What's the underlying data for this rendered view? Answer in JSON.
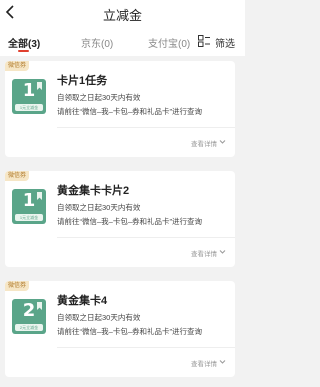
{
  "header": {
    "title": "立减金"
  },
  "tabs": [
    {
      "label": "全部(3)"
    },
    {
      "label": "京东(0)"
    },
    {
      "label": "支付宝(0)"
    }
  ],
  "filter_label": "筛选",
  "cards": [
    {
      "badge": "微信券",
      "thumb_num": "1",
      "thumb_label": "1元立减金",
      "name": "卡片1任务",
      "validity": "自领取之日起30天内有效",
      "note": "请前往“微信–我–卡包–券和礼品卡”进行查询",
      "details": "查看详情"
    },
    {
      "badge": "微信券",
      "thumb_num": "1",
      "thumb_label": "1元立减金",
      "name": "黄金集卡卡片2",
      "validity": "自领取之日起30天内有效",
      "note": "请前往“微信–我–卡包–券和礼品卡”进行查询",
      "details": "查看详情"
    },
    {
      "badge": "微信券",
      "thumb_num": "2",
      "thumb_label": "2元立减金",
      "name": "黄金集卡4",
      "validity": "自领取之日起30天内有效",
      "note": "请前往“微信–我–卡包–券和礼品卡”进行查询",
      "details": "查看详情"
    }
  ],
  "colors": {
    "accent": "#e0402f",
    "thumb_green": "#5aa589",
    "badge_bg": "#f6e6c6",
    "badge_text": "#b07a2a",
    "background": "#f2f2f2"
  },
  "icons": [
    "back-arrow-icon",
    "grid-icon",
    "chevron-down-icon",
    "bookmark-ribbon-icon"
  ]
}
